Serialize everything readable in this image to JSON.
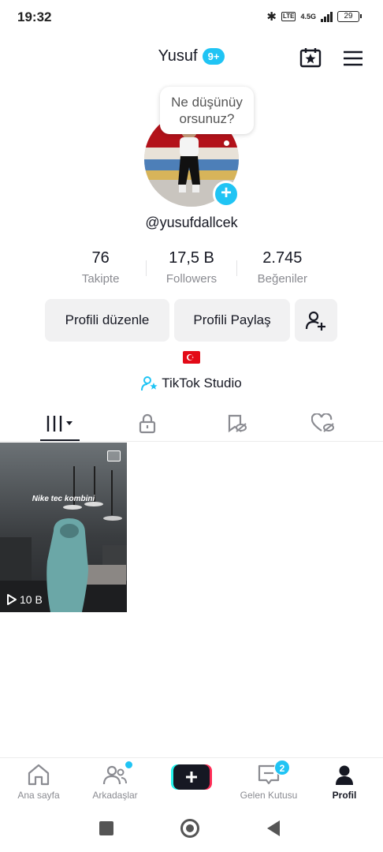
{
  "status_bar": {
    "time": "19:32",
    "network": "4.5G",
    "volte": "Vo LTE",
    "battery": "29"
  },
  "header": {
    "title": "Yusuf",
    "badge": "9+"
  },
  "profile": {
    "bubble_text": "Ne düşünüyorsunuz?",
    "bubble_line1": "Ne düşünüy",
    "bubble_line2": "orsunuz?",
    "username": "@yusufdallcek"
  },
  "stats": [
    {
      "value": "76",
      "label": "Takipte"
    },
    {
      "value": "17,5 B",
      "label": "Followers"
    },
    {
      "value": "2.745",
      "label": "Beğeniler"
    }
  ],
  "buttons": {
    "edit": "Profili düzenle",
    "share": "Profili Paylaş"
  },
  "studio_label": "TikTok Studio",
  "video": {
    "caption": "Nike tec kombini",
    "views": "10 B"
  },
  "bottom_nav": {
    "home": "Ana sayfa",
    "friends": "Arkadaşlar",
    "inbox": "Gelen Kutusu",
    "inbox_badge": "2",
    "profile": "Profil"
  },
  "colors": {
    "accent": "#20c4f4",
    "plus_left": "#25f4ee",
    "plus_right": "#fe2c55"
  }
}
